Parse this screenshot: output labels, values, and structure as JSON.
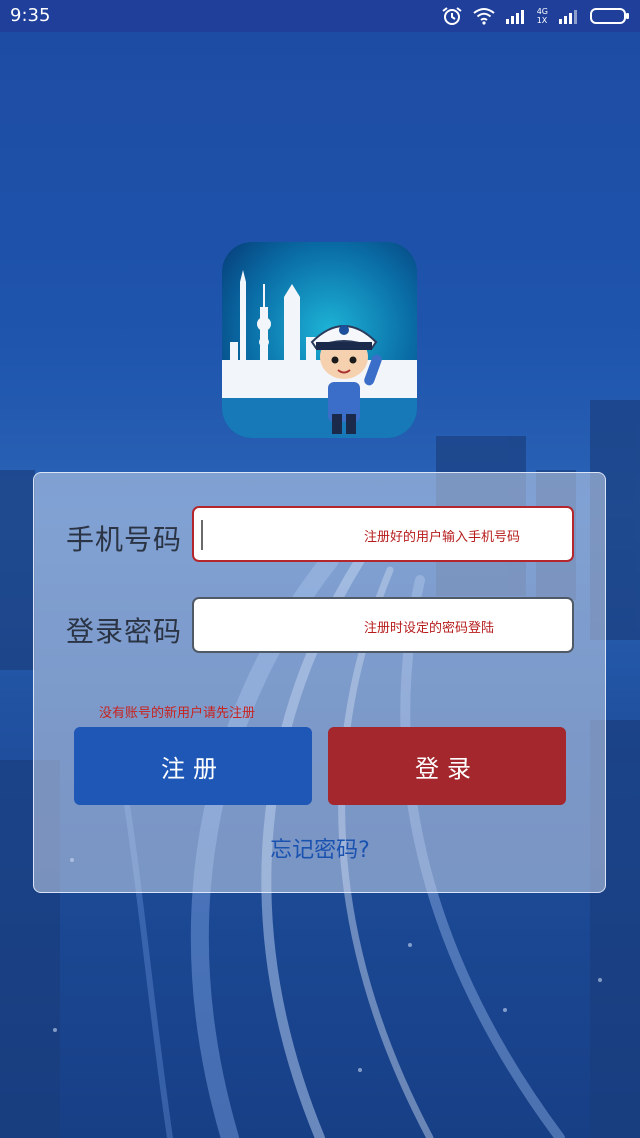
{
  "status_bar": {
    "time": "9:35",
    "network_label_top": "4G",
    "network_label_bottom": "1X",
    "icons": [
      "alarm-icon",
      "wifi-icon",
      "signal-icon",
      "signal-icon",
      "battery-icon"
    ]
  },
  "app": {
    "logo_icon": "traffic-police-cartoon-logo"
  },
  "form": {
    "phone_label": "手机号码",
    "phone_placeholder": "注册好的用户输入手机号码",
    "password_label": "登录密码",
    "password_placeholder": "注册时设定的密码登陆",
    "register_hint": "没有账号的新用户请先注册",
    "register_button": "注册",
    "login_button": "登录",
    "forgot_link": "忘记密码?"
  },
  "colors": {
    "register_button": "#1f57b7",
    "login_button": "#a3272c",
    "hint_text": "#c8231f",
    "forgot_link": "#1a52b0"
  }
}
